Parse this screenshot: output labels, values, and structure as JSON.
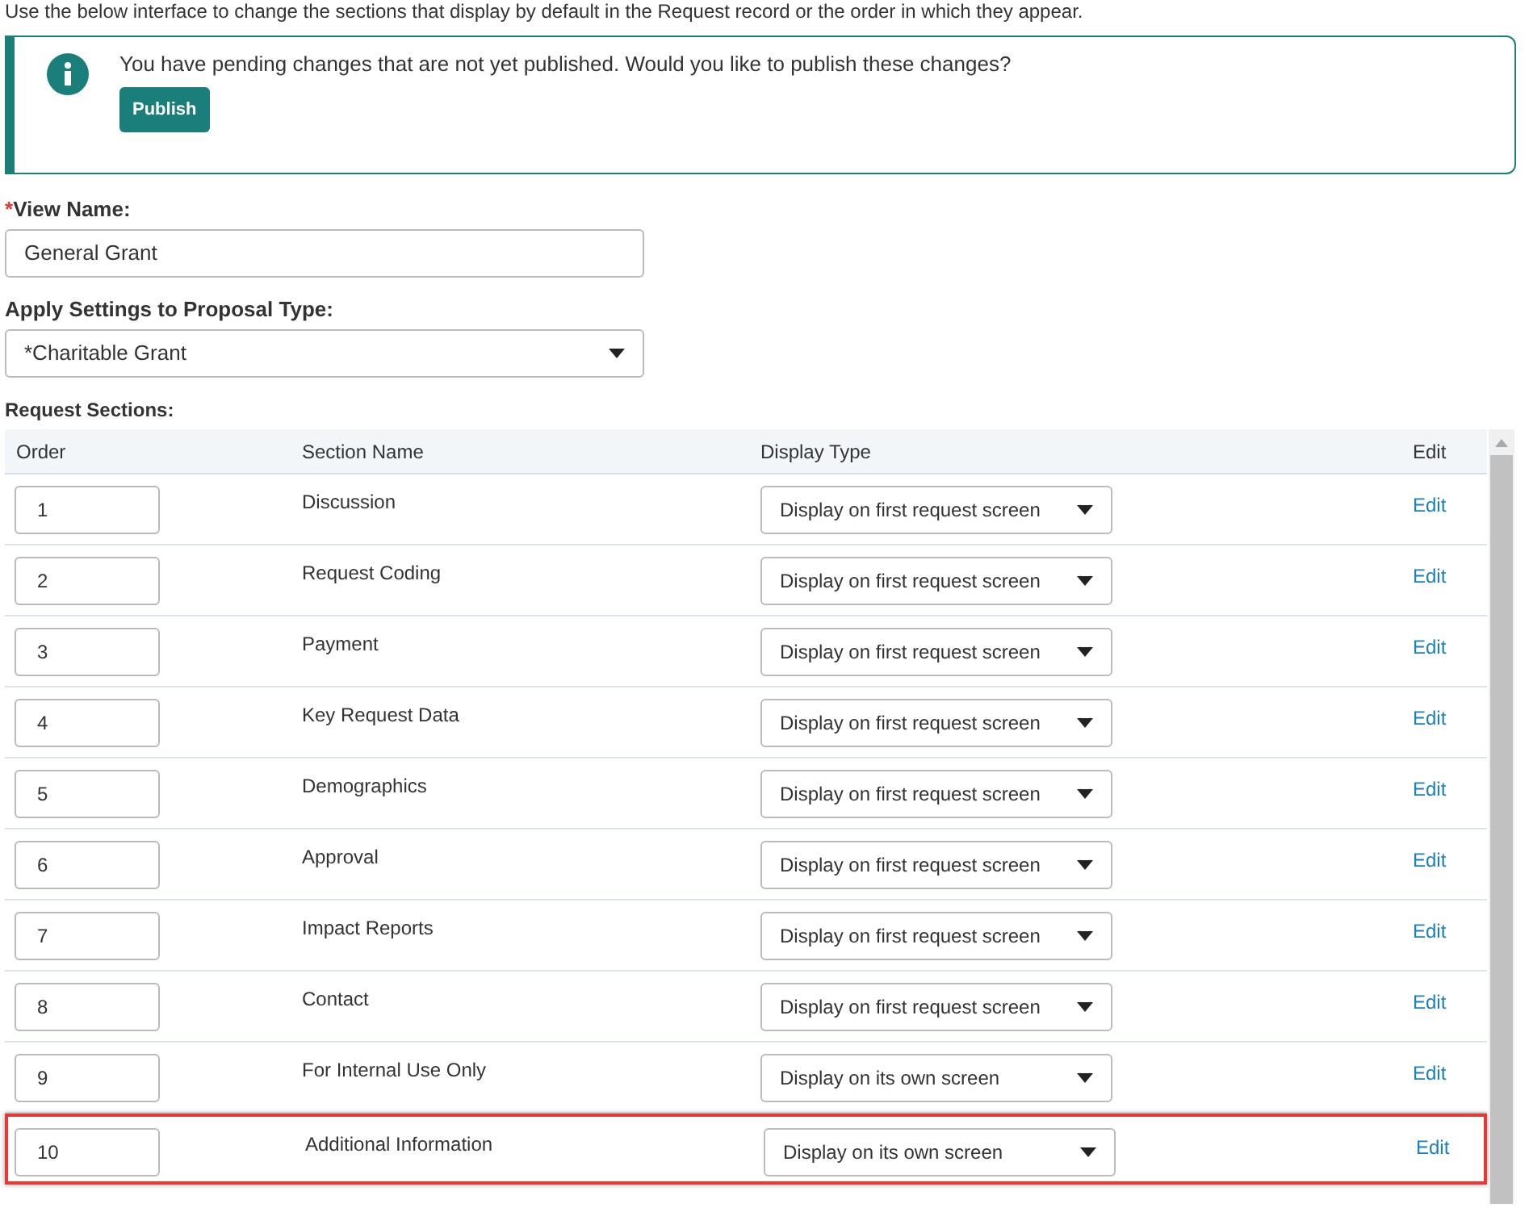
{
  "intro": "Use the below interface to change the sections that display by default in the Request record or the order in which they appear.",
  "notice": {
    "message": "You have pending changes that are not yet published. Would you like to publish these changes?",
    "button": "Publish"
  },
  "view_name": {
    "label": "View Name:",
    "required_mark": "*",
    "value": "General Grant"
  },
  "proposal_type": {
    "label": "Apply Settings to Proposal Type:",
    "value": "*Charitable Grant"
  },
  "sections": {
    "label": "Request Sections:",
    "columns": [
      "Order",
      "Section Name",
      "Display Type",
      "Edit"
    ],
    "rows": [
      {
        "order": "1",
        "name": "Discussion",
        "display": "Display on first request screen",
        "edit": "Edit",
        "highlighted": false
      },
      {
        "order": "2",
        "name": "Request Coding",
        "display": "Display on first request screen",
        "edit": "Edit",
        "highlighted": false
      },
      {
        "order": "3",
        "name": "Payment",
        "display": "Display on first request screen",
        "edit": "Edit",
        "highlighted": false
      },
      {
        "order": "4",
        "name": "Key Request Data",
        "display": "Display on first request screen",
        "edit": "Edit",
        "highlighted": false
      },
      {
        "order": "5",
        "name": "Demographics",
        "display": "Display on first request screen",
        "edit": "Edit",
        "highlighted": false
      },
      {
        "order": "6",
        "name": "Approval",
        "display": "Display on first request screen",
        "edit": "Edit",
        "highlighted": false
      },
      {
        "order": "7",
        "name": "Impact Reports",
        "display": "Display on first request screen",
        "edit": "Edit",
        "highlighted": false
      },
      {
        "order": "8",
        "name": "Contact",
        "display": "Display on first request screen",
        "edit": "Edit",
        "highlighted": false
      },
      {
        "order": "9",
        "name": "For Internal Use Only",
        "display": "Display on its own screen",
        "edit": "Edit",
        "highlighted": false
      },
      {
        "order": "10",
        "name": "Additional Information",
        "display": "Display on its own screen",
        "edit": "Edit",
        "highlighted": true
      }
    ]
  }
}
